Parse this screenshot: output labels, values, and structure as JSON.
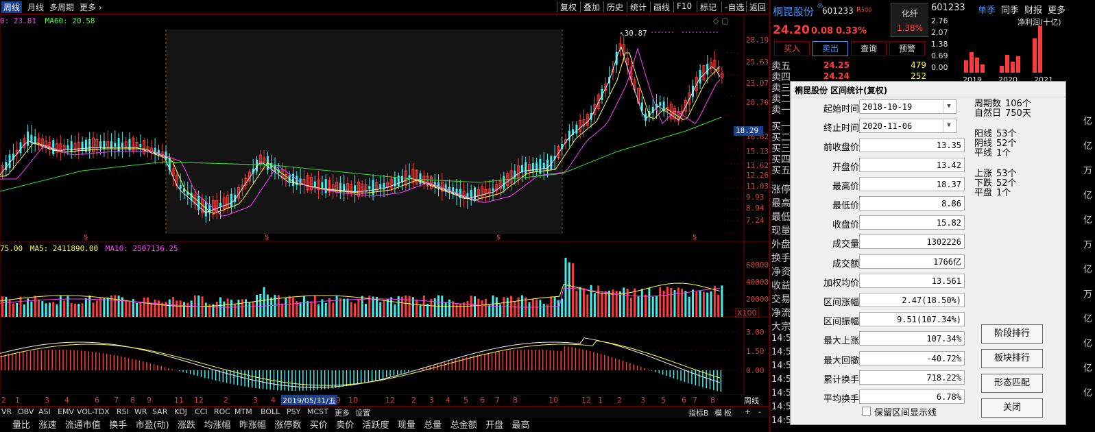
{
  "top_tabs": [
    "周线",
    "月线",
    "多周期",
    "更多"
  ],
  "top_right_buttons": [
    "复权",
    "叠加",
    "历史",
    "统计",
    "画线",
    "F10",
    "标记",
    "-自选",
    "返回"
  ],
  "price_axis_labels": [
    "28.19",
    "25.63",
    "23.07",
    "20.76",
    "18.29",
    "16.82",
    "15.13",
    "13.62",
    "12.26",
    "11.03",
    "9.93",
    "8.94",
    "7.24"
  ],
  "price_current_tag": "18.29",
  "max_price_label": "30.87",
  "ma_legend_top": {
    "left": "0: 23.81",
    "ma60": "MA60: 20.58"
  },
  "vol_legend": {
    "left": "75.00",
    "ma5": "MA5: 2411890.00",
    "ma10": "MA10: 2507136.25"
  },
  "vol_axis_labels": [
    "60000",
    "40000",
    "20000"
  ],
  "vol_unit": "X100",
  "macd_axis_labels": [
    "3.00",
    "1.50",
    "0.00"
  ],
  "time_axis_labels": [
    "2",
    "1",
    "3",
    "4",
    "6",
    "7",
    "8",
    "9",
    "11",
    "12",
    "2",
    "3",
    "4",
    "5",
    "9",
    "10",
    "12",
    "2",
    "3",
    "4",
    "5",
    "6",
    "7",
    "8",
    "10",
    "12",
    "1",
    "2",
    "3",
    "5",
    "6",
    "7",
    "8"
  ],
  "time_axis_selected": "2019/05/31/五",
  "time_axis_right": "周线",
  "dividend_mark": "$",
  "bottom_tabs": [
    "VR",
    "OBV",
    "ASI",
    "EMV",
    "VOL-TDX",
    "RSI",
    "WR",
    "SAR",
    "KDJ",
    "CCI",
    "ROC",
    "MTM",
    "BOLL",
    "PSY",
    "MCST",
    "更多",
    "设置"
  ],
  "bottom_right": [
    "指标B",
    "模",
    "板",
    "+",
    "-"
  ],
  "bottom_partial_text": "量比   涨速   流通市值   换手   市盈(动)   涨跌   均涨幅   昨涨幅   涨停数   买价   卖价   活跃度   现量   总量   总金额   开盘   最高",
  "stock": {
    "name": "桐昆股份",
    "code": "601233",
    "r_badge": "R",
    "r_value": "500",
    "price": "24.20",
    "change": "0.08",
    "change_pct": "0.33%",
    "industry": "化纤",
    "industry_pct": "1.38%"
  },
  "trade_buttons": [
    "买入",
    "卖出",
    "查询",
    "预警"
  ],
  "order_book": [
    {
      "label": "卖五",
      "price": "24.25",
      "vol": "479"
    },
    {
      "label": "卖四",
      "price": "24.24",
      "vol": "252"
    },
    {
      "label": "卖三",
      "price": "",
      "vol": ""
    },
    {
      "label": "卖二",
      "price": "",
      "vol": ""
    },
    {
      "label": "卖一",
      "price": "",
      "vol": ""
    }
  ],
  "buy_labels": [
    "买一",
    "买二",
    "买三",
    "买四",
    "买五"
  ],
  "side_labels": [
    "涨停",
    "最高",
    "最低",
    "现量",
    "外盘",
    "换手",
    "净资",
    "收益",
    "交易",
    "净流",
    "大宗"
  ],
  "tick_times": [
    "14:5",
    "14:5",
    "14:5",
    "14:5",
    "14:5",
    "14:5",
    "14:5"
  ],
  "far_right": {
    "code": "601233",
    "tabs": [
      "单季",
      "同季",
      "财报",
      "更多"
    ],
    "chart_title": "净利润(十亿)",
    "y_labels": [
      "2.76",
      "2.07",
      "1.38",
      "0.69",
      "0.00"
    ],
    "years": [
      "2019",
      "2020",
      "2021"
    ],
    "right_edge_units": [
      "亿",
      "亿",
      "万",
      "亿",
      "亿",
      "万",
      "亿",
      "万",
      "亿",
      "亿",
      "亿",
      "亿"
    ]
  },
  "dialog": {
    "title": "桐昆股份 区间统计(复权)",
    "fields": [
      {
        "label": "起始时间",
        "value": "2018-10-19",
        "type": "select"
      },
      {
        "label": "终止时间",
        "value": "2020-11-06",
        "type": "select"
      },
      {
        "label": "前收盘价",
        "value": "13.35"
      },
      {
        "label": "开盘价",
        "value": "13.42"
      },
      {
        "label": "最高价",
        "value": "18.37"
      },
      {
        "label": "最低价",
        "value": "8.86"
      },
      {
        "label": "收盘价",
        "value": "15.82"
      },
      {
        "label": "成交量",
        "value": "1302226"
      },
      {
        "label": "成交额",
        "value": "1766亿"
      },
      {
        "label": "加权均价",
        "value": "13.561"
      },
      {
        "label": "区间涨幅",
        "value": "2.47(18.50%)"
      },
      {
        "label": "区间振幅",
        "value": "9.51(107.34%)"
      },
      {
        "label": "最大上涨",
        "value": "107.34%"
      },
      {
        "label": "最大回撤",
        "value": "-40.72%"
      },
      {
        "label": "累计换手",
        "value": "718.22%"
      },
      {
        "label": "平均换手",
        "value": "6.78%"
      }
    ],
    "stats": [
      {
        "k": "周期数",
        "v": "106个"
      },
      {
        "k": "自然日",
        "v": "750天"
      },
      {
        "k": "阳线",
        "v": "53个"
      },
      {
        "k": "阴线",
        "v": "52个"
      },
      {
        "k": "平线",
        "v": "1个"
      },
      {
        "k": "上涨",
        "v": "53个"
      },
      {
        "k": "下跌",
        "v": "52个"
      },
      {
        "k": "平盘",
        "v": "1个"
      }
    ],
    "buttons": [
      "阶段排行",
      "板块排行",
      "形态匹配",
      "关闭"
    ],
    "checkbox_label": "保留区间显示线"
  }
}
